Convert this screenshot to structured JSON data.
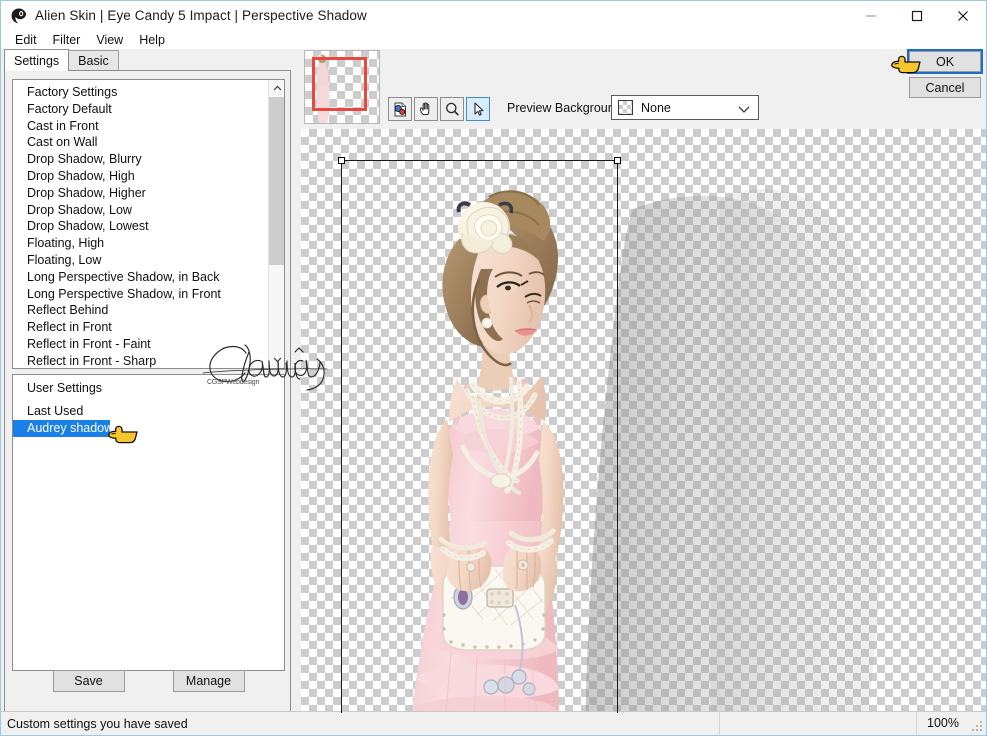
{
  "window": {
    "title": "Alien Skin | Eye Candy 5 Impact | Perspective Shadow",
    "logo_icon": "alien-skin-logo-icon",
    "minimize_icon": "minimize-icon",
    "maximize_icon": "maximize-icon",
    "close_icon": "close-icon"
  },
  "menubar": {
    "items": [
      {
        "label": "Edit"
      },
      {
        "label": "Filter"
      },
      {
        "label": "View"
      },
      {
        "label": "Help"
      }
    ]
  },
  "tabs": [
    {
      "label": "Settings",
      "active": true
    },
    {
      "label": "Basic",
      "active": false
    }
  ],
  "factory_list": {
    "scroll_up_icon": "chevron-up-icon",
    "scroll_down_icon": "chevron-down-icon",
    "items": [
      {
        "label": "Factory Settings",
        "type": "group"
      },
      {
        "label": "Factory Default",
        "type": "item"
      },
      {
        "label": "Cast in Front",
        "type": "item"
      },
      {
        "label": "Cast on Wall",
        "type": "item"
      },
      {
        "label": "Drop Shadow, Blurry",
        "type": "item"
      },
      {
        "label": "Drop Shadow, High",
        "type": "item"
      },
      {
        "label": "Drop Shadow, Higher",
        "type": "item"
      },
      {
        "label": "Drop Shadow, Low",
        "type": "item"
      },
      {
        "label": "Drop Shadow, Lowest",
        "type": "item"
      },
      {
        "label": "Floating, High",
        "type": "item"
      },
      {
        "label": "Floating, Low",
        "type": "item"
      },
      {
        "label": "Long Perspective Shadow, in Back",
        "type": "item"
      },
      {
        "label": "Long Perspective Shadow, in Front",
        "type": "item"
      },
      {
        "label": "Reflect Behind",
        "type": "item"
      },
      {
        "label": "Reflect in Front",
        "type": "item"
      },
      {
        "label": "Reflect in Front - Faint",
        "type": "item"
      },
      {
        "label": "Reflect in Front - Sharp",
        "type": "item"
      }
    ]
  },
  "user_list": {
    "items": [
      {
        "label": "User Settings",
        "type": "group",
        "selected": false
      },
      {
        "label": "Last Used",
        "type": "item",
        "selected": false
      },
      {
        "label": "Audrey shadow",
        "type": "item",
        "selected": true
      }
    ]
  },
  "panel_buttons": {
    "save_label": "Save",
    "manage_label": "Manage"
  },
  "preview_toolbar": {
    "navigator_icon": "navigator-thumbnail",
    "viewport_rect_color": "#e8483f",
    "tools": [
      {
        "name": "color-picker-tool-icon",
        "active": false
      },
      {
        "name": "hand-pan-tool-icon",
        "active": false
      },
      {
        "name": "zoom-magnifier-tool-icon",
        "active": false
      },
      {
        "name": "arrow-select-tool-icon",
        "active": true
      }
    ],
    "preview_background_label": "Preview Background:",
    "preview_background_value": "None",
    "preview_background_options": [
      "None"
    ],
    "dropdown_arrow_icon": "chevron-down-icon"
  },
  "dialog_buttons": {
    "ok_label": "OK",
    "cancel_label": "Cancel"
  },
  "watermark": {
    "script_text": "Claudia",
    "subtext": "CGSPWebdesign"
  },
  "statusbar": {
    "message": "Custom settings you have saved",
    "zoom": "100%",
    "grip_icon": "resize-grip-icon"
  },
  "colors": {
    "selection_blue": "#1b7fe8",
    "focus_blue": "#1a6fc4",
    "checker_gray": "#cccccc",
    "panel_gray": "#f0f0f0"
  },
  "cursors": [
    {
      "name": "hand-pointer-cursor-ok",
      "target": "ok-button"
    },
    {
      "name": "hand-pointer-cursor-user-setting",
      "target": "user-list-selected-item"
    }
  ]
}
